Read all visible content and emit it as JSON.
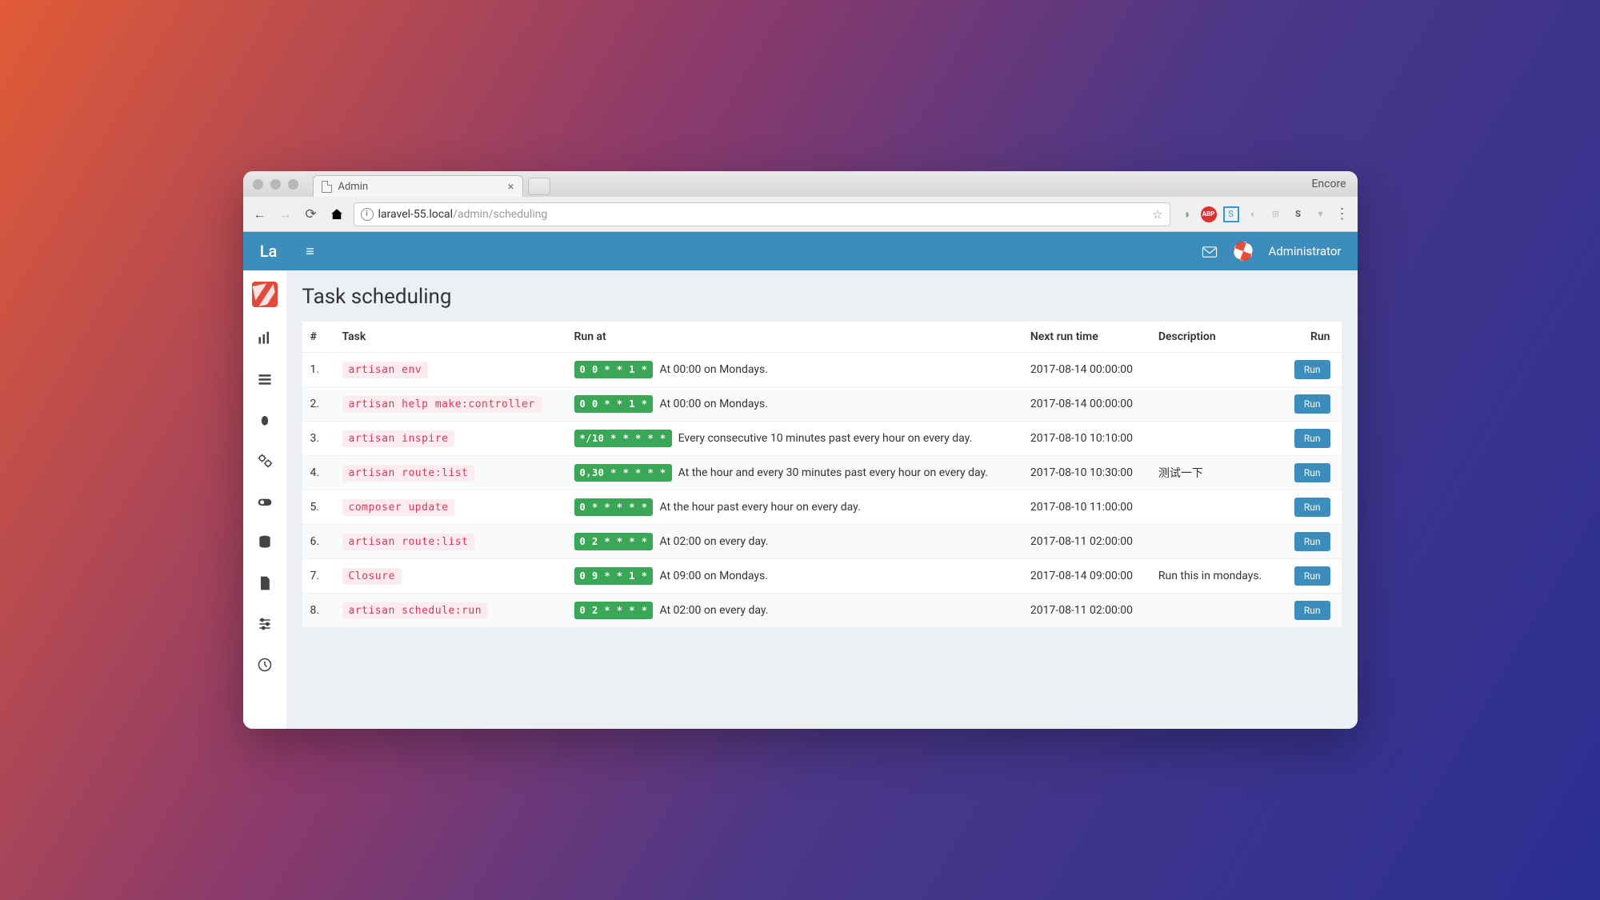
{
  "browser": {
    "tab_title": "Admin",
    "encore": "Encore",
    "url_host": "laravel-55.local",
    "url_path": "/admin/scheduling"
  },
  "header": {
    "logo": "La",
    "username": "Administrator"
  },
  "page": {
    "title": "Task scheduling"
  },
  "columns": {
    "idx": "#",
    "task": "Task",
    "runat": "Run at",
    "next": "Next run time",
    "desc": "Description",
    "run": "Run"
  },
  "run_label": "Run",
  "tasks": [
    {
      "idx": "1.",
      "cmd": "artisan env",
      "cron": "0 0 * * 1 *",
      "human": "At 00:00 on Mondays.",
      "next": "2017-08-14 00:00:00",
      "desc": ""
    },
    {
      "idx": "2.",
      "cmd": "artisan help make:controller",
      "cron": "0 0 * * 1 *",
      "human": "At 00:00 on Mondays.",
      "next": "2017-08-14 00:00:00",
      "desc": ""
    },
    {
      "idx": "3.",
      "cmd": "artisan inspire",
      "cron": "*/10 * * * * *",
      "human": "Every consecutive 10 minutes past every hour on every day.",
      "next": "2017-08-10 10:10:00",
      "desc": ""
    },
    {
      "idx": "4.",
      "cmd": "artisan route:list",
      "cron": "0,30 * * * * *",
      "human": "At the hour and every 30 minutes past every hour on every day.",
      "next": "2017-08-10 10:30:00",
      "desc": "测试一下"
    },
    {
      "idx": "5.",
      "cmd": "composer update",
      "cron": "0 * * * * *",
      "human": "At the hour past every hour on every day.",
      "next": "2017-08-10 11:00:00",
      "desc": ""
    },
    {
      "idx": "6.",
      "cmd": "artisan route:list",
      "cron": "0 2 * * * *",
      "human": "At 02:00 on every day.",
      "next": "2017-08-11 02:00:00",
      "desc": ""
    },
    {
      "idx": "7.",
      "cmd": "Closure",
      "cron": "0 9 * * 1 *",
      "human": "At 09:00 on Mondays.",
      "next": "2017-08-14 09:00:00",
      "desc": "Run this in mondays."
    },
    {
      "idx": "8.",
      "cmd": "artisan schedule:run",
      "cron": "0 2 * * * *",
      "human": "At 02:00 on every day.",
      "next": "2017-08-11 02:00:00",
      "desc": ""
    }
  ]
}
